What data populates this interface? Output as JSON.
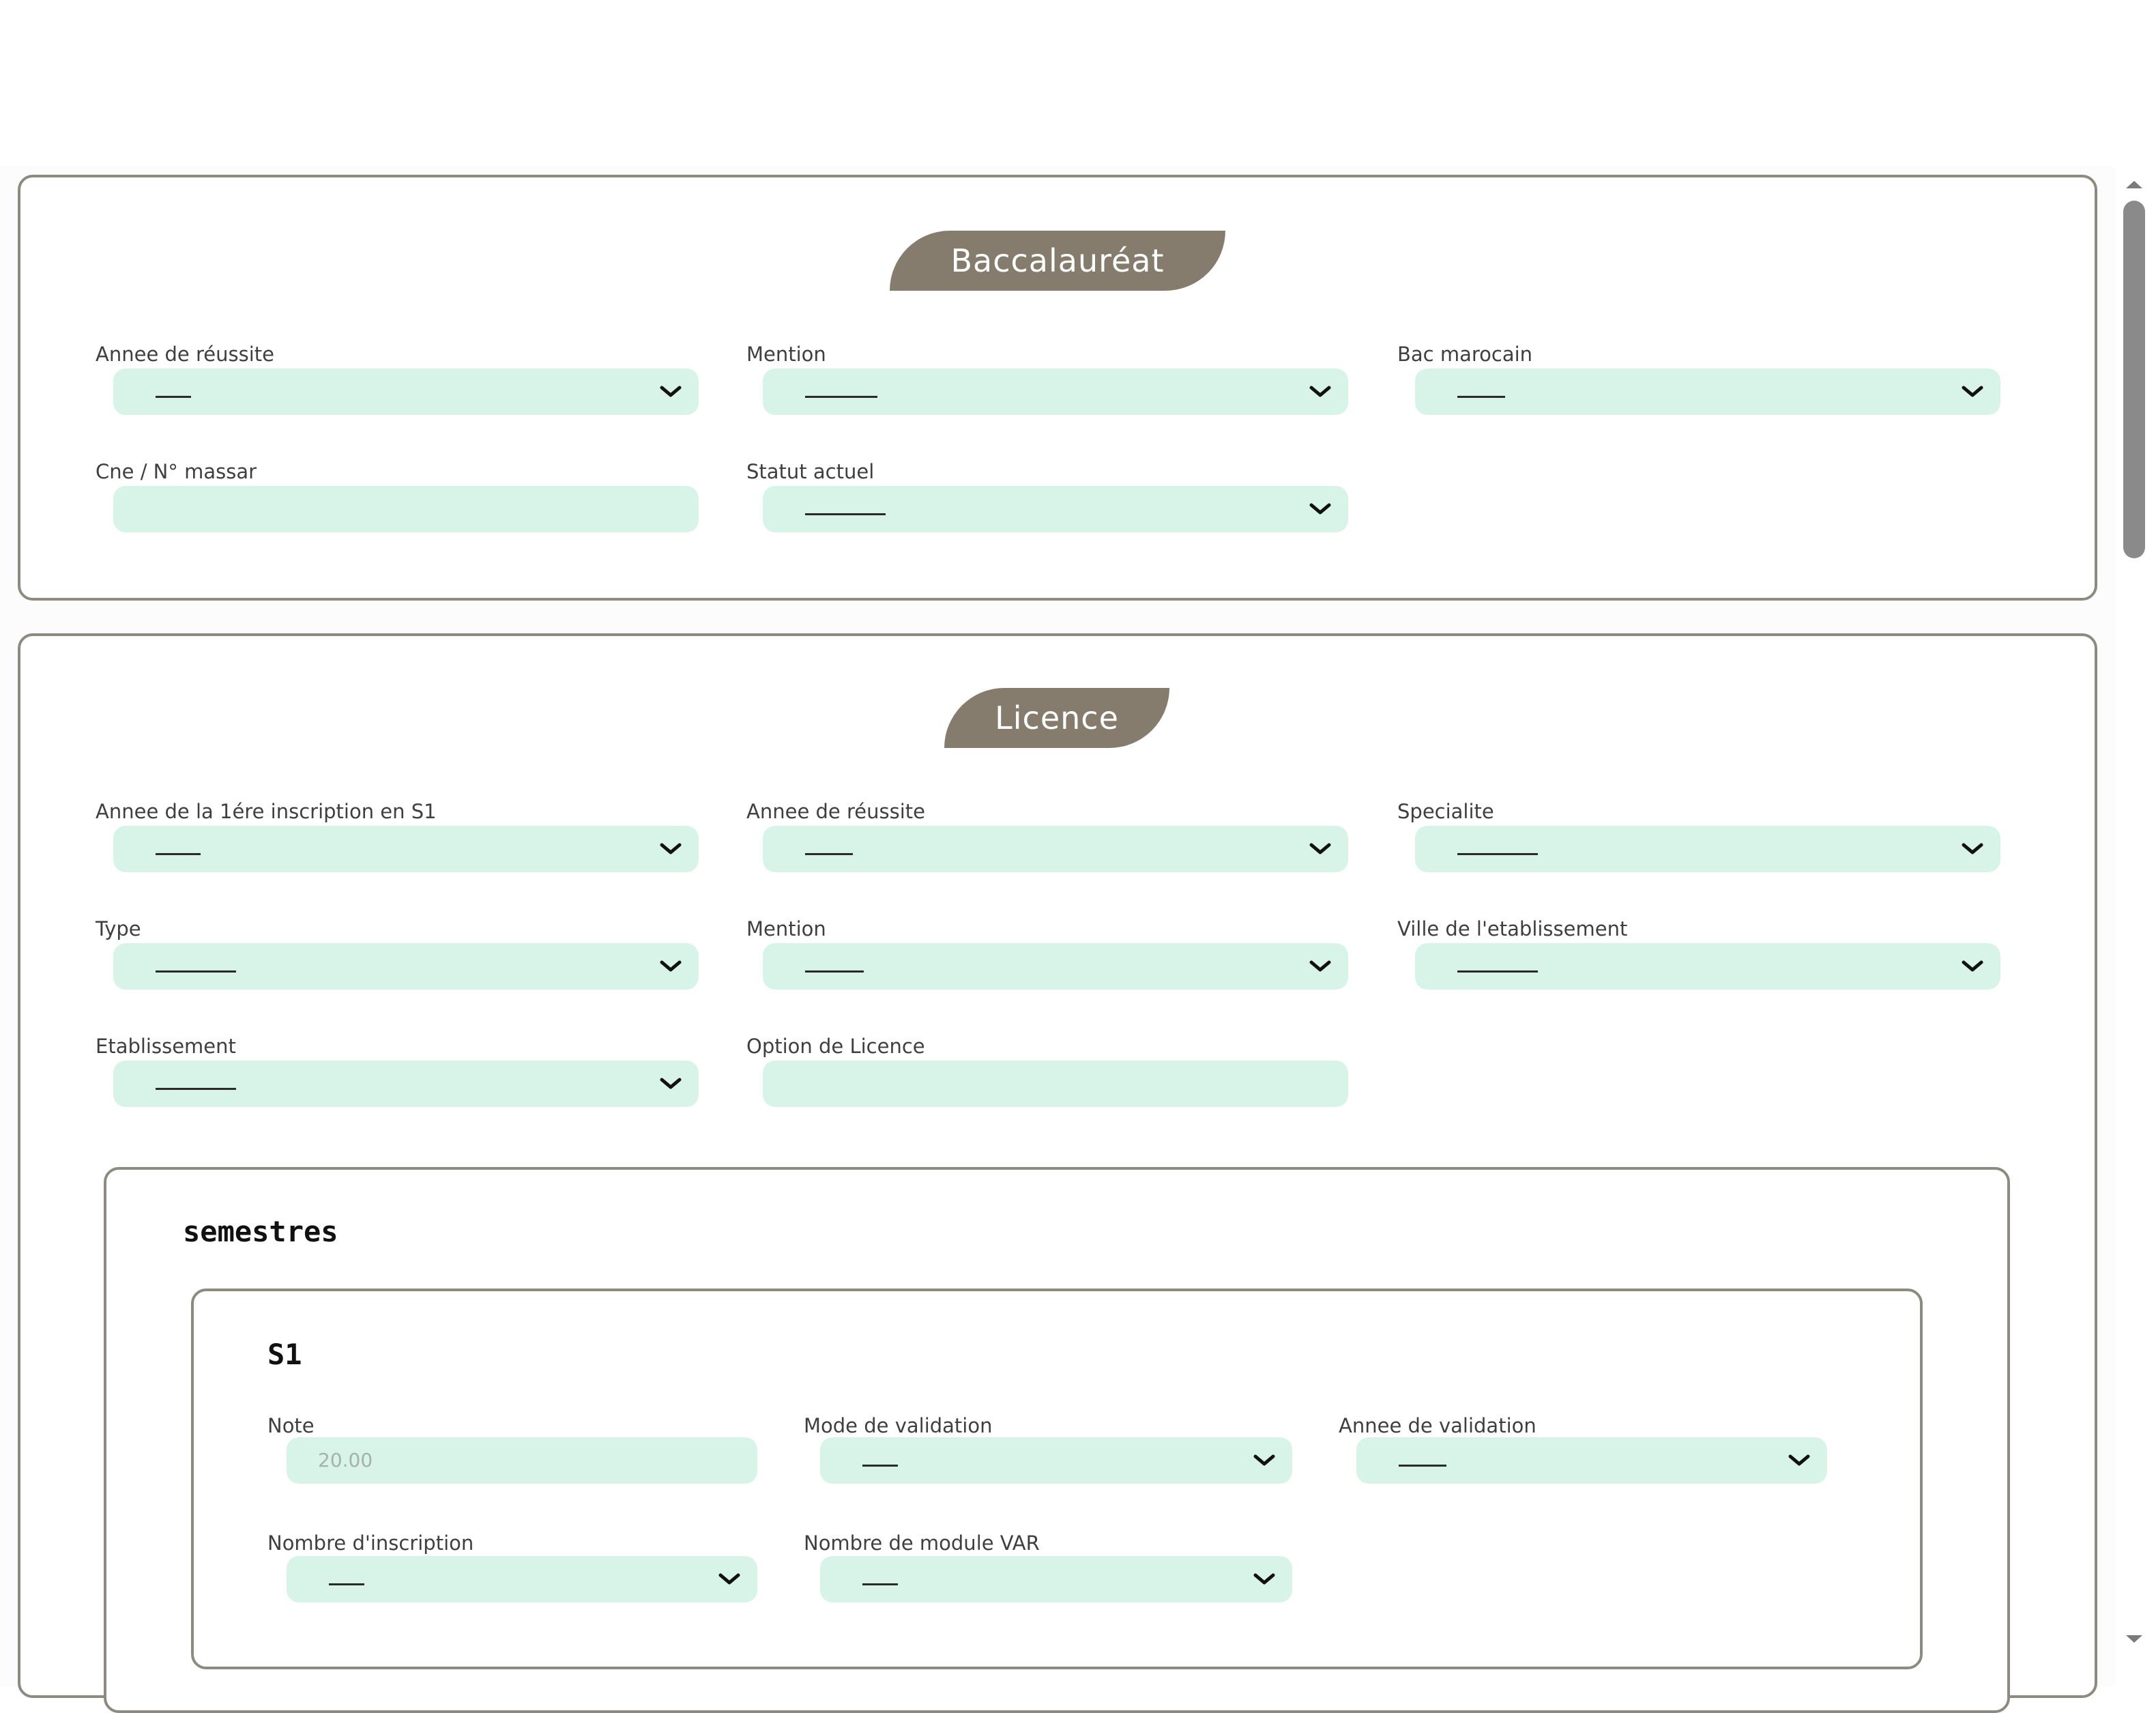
{
  "baccalaureat": {
    "title": "Baccalauréat",
    "fields": {
      "annee_reussite": {
        "label": "Annee de réussite",
        "value": "___"
      },
      "mention": {
        "label": "Mention",
        "value": "_____"
      },
      "bac_marocain": {
        "label": "Bac marocain",
        "value": "____"
      },
      "cne": {
        "label": "Cne / N° massar",
        "value": ""
      },
      "statut_actuel": {
        "label": "Statut actuel",
        "value": "______"
      }
    }
  },
  "licence": {
    "title": "Licence",
    "fields": {
      "annee_1ere_inscription": {
        "label": "Annee de la 1ére inscription en S1",
        "value": "____"
      },
      "annee_reussite": {
        "label": "Annee de réussite",
        "value": "____"
      },
      "specialite": {
        "label": "Specialite",
        "value": "______"
      },
      "type": {
        "label": "Type",
        "value": "______"
      },
      "mention": {
        "label": "Mention",
        "value": "_____"
      },
      "ville_etablissement": {
        "label": "Ville de l'etablissement",
        "value": "______"
      },
      "etablissement": {
        "label": "Etablissement",
        "value": "______"
      },
      "option_licence": {
        "label": "Option de Licence",
        "value": ""
      }
    },
    "semestres": {
      "title": "semestres",
      "s1": {
        "title": "S1",
        "note": {
          "label": "Note",
          "placeholder": "20.00"
        },
        "mode_validation": {
          "label": "Mode de validation",
          "value": "___"
        },
        "annee_validation": {
          "label": "Annee de validation",
          "value": "____"
        },
        "nombre_inscription": {
          "label": "Nombre d'inscription",
          "value": "___"
        },
        "nombre_module_var": {
          "label": "Nombre de module VAR",
          "value": "___"
        }
      }
    }
  },
  "colors": {
    "pill": "#857c6d",
    "field_bg": "#d8f4e9",
    "border": "#8f8a80"
  },
  "icons": {
    "select": "chevron-down-icon",
    "scroll_up": "arrow-up-icon",
    "scroll_down": "arrow-down-icon"
  }
}
